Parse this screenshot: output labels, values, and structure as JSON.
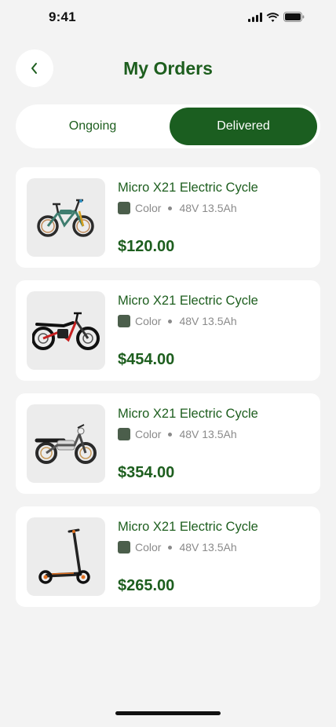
{
  "status_bar": {
    "time": "9:41"
  },
  "header": {
    "title": "My Orders"
  },
  "tabs": [
    {
      "label": "Ongoing",
      "active": false
    },
    {
      "label": "Delivered",
      "active": true
    }
  ],
  "orders": [
    {
      "name": "Micro X21 Electric Cycle",
      "color_label": "Color",
      "spec": "48V 13.5Ah",
      "price": "$120.00",
      "image": "folding-ebike"
    },
    {
      "name": "Micro X21 Electric Cycle",
      "color_label": "Color",
      "spec": "48V 13.5Ah",
      "price": "$454.00",
      "image": "dirt-ebike"
    },
    {
      "name": "Micro X21 Electric Cycle",
      "color_label": "Color",
      "spec": "48V 13.5Ah",
      "price": "$354.00",
      "image": "scrambler-ebike"
    },
    {
      "name": "Micro X21 Electric Cycle",
      "color_label": "Color",
      "spec": "48V 13.5Ah",
      "price": "$265.00",
      "image": "electric-scooter"
    }
  ],
  "colors": {
    "brand": "#1b5e20",
    "swatch": "#4b5e4b",
    "background": "#f3f3f3"
  }
}
